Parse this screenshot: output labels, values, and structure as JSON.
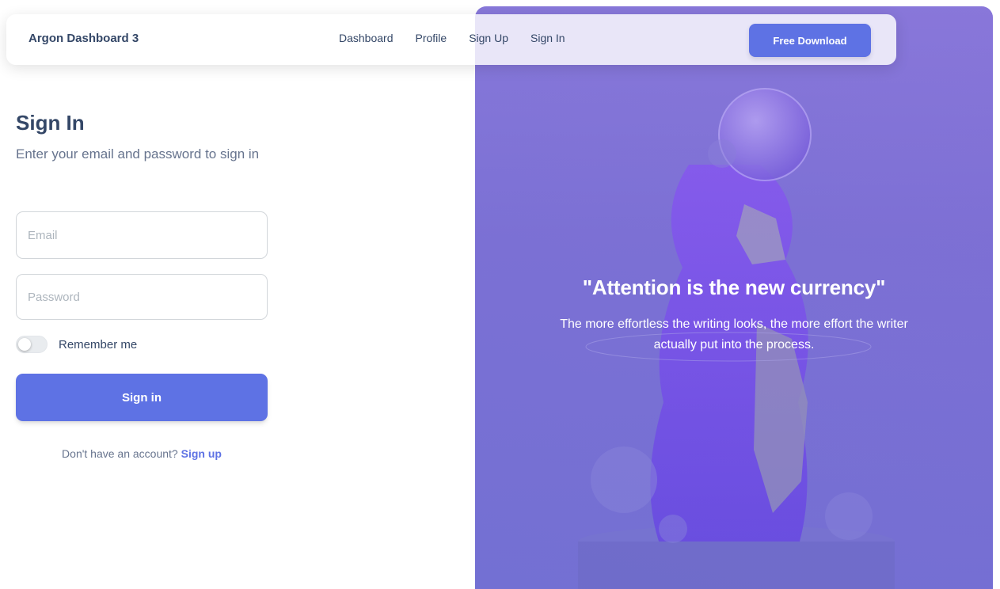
{
  "navbar": {
    "brand": "Argon Dashboard 3",
    "links": [
      "Dashboard",
      "Profile",
      "Sign Up",
      "Sign In"
    ],
    "download_label": "Free Download"
  },
  "signin": {
    "title": "Sign In",
    "subtitle": "Enter your email and password to sign in",
    "email_placeholder": "Email",
    "password_placeholder": "Password",
    "remember_label": "Remember me",
    "remember_checked": false,
    "submit_label": "Sign in",
    "no_account_text": "Don't have an account?",
    "signup_link": "Sign up"
  },
  "hero": {
    "quote": "\"Attention is the new currency\"",
    "description": "The more effortless the writing looks, the more effort the writer actually put into the process."
  },
  "colors": {
    "primary": "#5e72e4",
    "heading": "#344767",
    "text_muted": "#67748e",
    "hero_bg": "#8b7fd6"
  }
}
